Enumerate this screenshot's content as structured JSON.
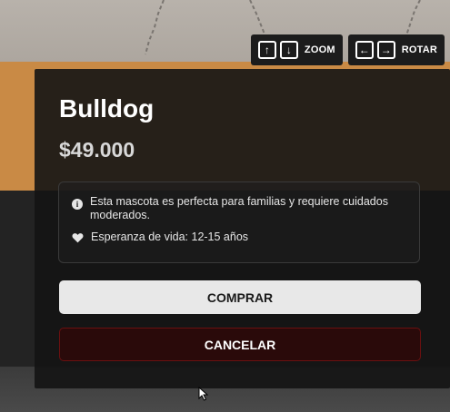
{
  "controls": {
    "zoom": {
      "keys": [
        "↑",
        "↓"
      ],
      "label": "ZOOM"
    },
    "rotate": {
      "keys": [
        "←",
        "→"
      ],
      "label": "ROTAR"
    }
  },
  "product": {
    "name": "Bulldog",
    "price": "$49.000",
    "info": [
      {
        "icon": "info-icon",
        "text": "Esta mascota es perfecta para familias y requiere cuidados moderados."
      },
      {
        "icon": "heart-icon",
        "text": "Esperanza de vida: 12-15 años"
      }
    ]
  },
  "actions": {
    "buy_label": "COMPRAR",
    "cancel_label": "CANCELAR"
  },
  "colors": {
    "panel_bg": "#141414",
    "buy_bg": "#e8e8e8",
    "cancel_border": "#6a1010"
  }
}
